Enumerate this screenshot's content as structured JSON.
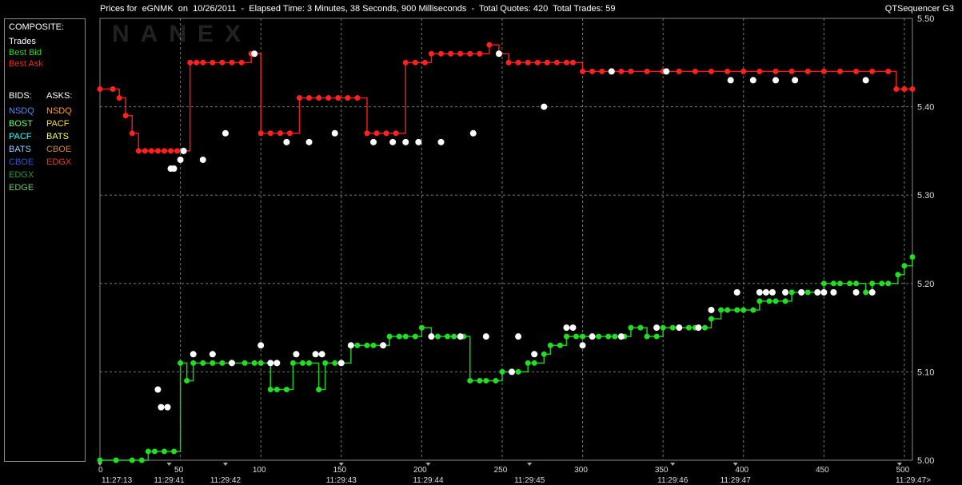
{
  "header": {
    "title": "Prices for  eGNMK  on  10/26/2011  -  Elapsed Time: 3 Minutes, 38 Seconds, 900 Milliseconds  -  Total Quotes: 420  Total Trades: 59",
    "app_name": "QTSequencer G3"
  },
  "watermark": "NANEX",
  "legend": {
    "composite_label": "COMPOSITE:",
    "composite_items": [
      {
        "label": "Trades",
        "color": "#ffffff"
      },
      {
        "label": "Best Bid",
        "color": "#22dd22"
      },
      {
        "label": "Best Ask",
        "color": "#ff2020"
      }
    ],
    "bids_label": "BIDS:",
    "asks_label": "ASKS:",
    "bids": [
      {
        "label": "NSDQ",
        "color": "#4a8cff"
      },
      {
        "label": "BOST",
        "color": "#66ff66"
      },
      {
        "label": "PACF",
        "color": "#33ffff"
      },
      {
        "label": "BATS",
        "color": "#99ccff"
      },
      {
        "label": "CBOE",
        "color": "#3355cc"
      },
      {
        "label": "EDGX",
        "color": "#229944"
      },
      {
        "label": "EDGE",
        "color": "#66cc66"
      }
    ],
    "asks": [
      {
        "label": "NSDQ",
        "color": "#ff9933"
      },
      {
        "label": "PACF",
        "color": "#ffdd33"
      },
      {
        "label": "BATS",
        "color": "#ffff66"
      },
      {
        "label": "CBOE",
        "color": "#cc8844"
      },
      {
        "label": "EDGX",
        "color": "#dd4422"
      }
    ]
  },
  "chart_data": {
    "type": "line",
    "title": "",
    "xlabel": "",
    "ylabel": "",
    "xlim": [
      0,
      505
    ],
    "ylim": [
      5.0,
      5.5
    ],
    "yticks": [
      "5.00",
      "5.10",
      "5.20",
      "5.30",
      "5.40",
      "5.50"
    ],
    "xticks": [
      "0",
      "50",
      "100",
      "150",
      "200",
      "250",
      "300",
      "350",
      "400",
      "450",
      "500"
    ],
    "time_labels": [
      {
        "x": 0,
        "label": "11:27:13"
      },
      {
        "x": 43,
        "label": "11:29:41"
      },
      {
        "x": 78,
        "label": "11:29:42"
      },
      {
        "x": 150,
        "label": "11:29:43"
      },
      {
        "x": 204,
        "label": "11:29:44"
      },
      {
        "x": 267,
        "label": "11:29:45"
      },
      {
        "x": 356,
        "label": "11:29:46"
      },
      {
        "x": 395,
        "label": "11:29:47"
      },
      {
        "x": 497,
        "label": "11:29:47>"
      }
    ],
    "grid": true,
    "series": [
      {
        "name": "Best Ask",
        "color": "#ff2020",
        "x": [
          0,
          8,
          12,
          16,
          20,
          24,
          28,
          32,
          36,
          40,
          44,
          48,
          52,
          56,
          60,
          64,
          70,
          76,
          82,
          88,
          94,
          100,
          106,
          112,
          118,
          124,
          130,
          136,
          142,
          148,
          154,
          160,
          166,
          172,
          178,
          184,
          190,
          196,
          202,
          206,
          212,
          218,
          224,
          230,
          236,
          242,
          248,
          254,
          260,
          266,
          272,
          278,
          284,
          290,
          294,
          300,
          306,
          312,
          318,
          324,
          330,
          340,
          350,
          360,
          370,
          380,
          390,
          400,
          410,
          420,
          430,
          440,
          450,
          460,
          470,
          480,
          490,
          495,
          500,
          505
        ],
        "y": [
          5.42,
          5.42,
          5.41,
          5.39,
          5.37,
          5.35,
          5.35,
          5.35,
          5.35,
          5.35,
          5.35,
          5.35,
          5.35,
          5.45,
          5.45,
          5.45,
          5.45,
          5.45,
          5.45,
          5.45,
          5.46,
          5.37,
          5.37,
          5.37,
          5.37,
          5.41,
          5.41,
          5.41,
          5.41,
          5.41,
          5.41,
          5.41,
          5.37,
          5.37,
          5.37,
          5.37,
          5.45,
          5.45,
          5.45,
          5.46,
          5.46,
          5.46,
          5.46,
          5.46,
          5.46,
          5.47,
          5.46,
          5.45,
          5.45,
          5.45,
          5.45,
          5.45,
          5.45,
          5.45,
          5.45,
          5.44,
          5.44,
          5.44,
          5.44,
          5.44,
          5.44,
          5.44,
          5.44,
          5.44,
          5.44,
          5.44,
          5.44,
          5.44,
          5.44,
          5.44,
          5.44,
          5.44,
          5.44,
          5.44,
          5.44,
          5.44,
          5.44,
          5.42,
          5.42,
          5.42
        ]
      },
      {
        "name": "Best Bid",
        "color": "#22dd22",
        "x": [
          0,
          10,
          20,
          26,
          30,
          34,
          40,
          46,
          50,
          54,
          58,
          64,
          70,
          76,
          82,
          90,
          96,
          100,
          106,
          110,
          116,
          120,
          126,
          130,
          136,
          140,
          146,
          150,
          156,
          160,
          166,
          170,
          176,
          180,
          186,
          190,
          196,
          200,
          206,
          210,
          216,
          220,
          226,
          230,
          236,
          240,
          246,
          250,
          256,
          260,
          266,
          270,
          276,
          280,
          286,
          290,
          296,
          300,
          306,
          310,
          316,
          320,
          326,
          330,
          336,
          340,
          346,
          350,
          356,
          360,
          366,
          370,
          376,
          380,
          386,
          390,
          396,
          400,
          406,
          410,
          416,
          420,
          426,
          430,
          436,
          440,
          446,
          450,
          456,
          460,
          466,
          470,
          476,
          480,
          486,
          490,
          496,
          500,
          505
        ],
        "y": [
          5.0,
          5.0,
          5.0,
          5.0,
          5.01,
          5.01,
          5.01,
          5.01,
          5.11,
          5.09,
          5.11,
          5.11,
          5.11,
          5.11,
          5.11,
          5.11,
          5.11,
          5.11,
          5.08,
          5.08,
          5.08,
          5.11,
          5.11,
          5.11,
          5.08,
          5.11,
          5.11,
          5.11,
          5.13,
          5.13,
          5.13,
          5.13,
          5.13,
          5.14,
          5.14,
          5.14,
          5.14,
          5.15,
          5.14,
          5.14,
          5.14,
          5.14,
          5.14,
          5.09,
          5.09,
          5.09,
          5.09,
          5.1,
          5.1,
          5.1,
          5.11,
          5.11,
          5.12,
          5.13,
          5.13,
          5.14,
          5.14,
          5.14,
          5.14,
          5.14,
          5.14,
          5.14,
          5.14,
          5.15,
          5.15,
          5.14,
          5.14,
          5.15,
          5.15,
          5.15,
          5.15,
          5.15,
          5.15,
          5.16,
          5.17,
          5.17,
          5.17,
          5.17,
          5.17,
          5.18,
          5.18,
          5.18,
          5.18,
          5.19,
          5.19,
          5.19,
          5.19,
          5.2,
          5.2,
          5.2,
          5.2,
          5.2,
          5.19,
          5.2,
          5.2,
          5.2,
          5.21,
          5.22,
          5.23
        ]
      },
      {
        "name": "Trades",
        "color": "#ffffff",
        "x": [
          36,
          38,
          42,
          44,
          46,
          50,
          52,
          58,
          64,
          70,
          78,
          82,
          96,
          100,
          106,
          110,
          116,
          122,
          130,
          134,
          138,
          146,
          150,
          156,
          170,
          176,
          182,
          190,
          198,
          206,
          212,
          224,
          232,
          240,
          248,
          256,
          260,
          270,
          276,
          290,
          294,
          300,
          306,
          318,
          324,
          346,
          352,
          360,
          372,
          380,
          392,
          396,
          406,
          410,
          414,
          418,
          420,
          426,
          432,
          436,
          446,
          450,
          456,
          470,
          476,
          480
        ],
        "y": [
          5.08,
          5.06,
          5.06,
          5.33,
          5.33,
          5.34,
          5.35,
          5.12,
          5.34,
          5.12,
          5.37,
          5.11,
          5.46,
          5.13,
          5.11,
          5.11,
          5.36,
          5.12,
          5.36,
          5.12,
          5.12,
          5.37,
          5.11,
          5.13,
          5.36,
          5.13,
          5.36,
          5.36,
          5.36,
          5.14,
          5.36,
          5.14,
          5.37,
          5.14,
          5.46,
          5.1,
          5.14,
          5.12,
          5.4,
          5.15,
          5.15,
          5.13,
          5.14,
          5.44,
          5.14,
          5.15,
          5.44,
          5.15,
          5.15,
          5.17,
          5.43,
          5.19,
          5.43,
          5.19,
          5.19,
          5.19,
          5.43,
          5.19,
          5.43,
          5.19,
          5.19,
          5.19,
          5.19,
          5.19,
          5.43,
          5.19
        ]
      }
    ]
  }
}
